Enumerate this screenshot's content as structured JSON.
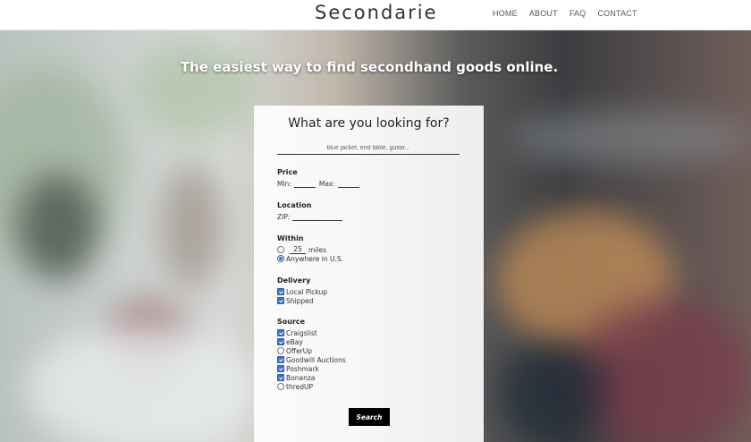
{
  "header": {
    "logo": "Secondarie",
    "nav": [
      "HOME",
      "ABOUT",
      "FAQ",
      "CONTACT"
    ]
  },
  "hero": {
    "tagline": "The easiest way to find secondhand goods online."
  },
  "search": {
    "title": "What are you looking for?",
    "placeholder": "blue jacket, end table, guitar...",
    "price": {
      "label": "Price",
      "min_label": "Min:",
      "max_label": "Max:"
    },
    "location": {
      "label": "Location",
      "zip_label": "ZIP:"
    },
    "within": {
      "label": "Within",
      "miles_value": "25",
      "miles_label": "miles",
      "anywhere_label": "Anywhere in U.S.",
      "selected": "anywhere"
    },
    "delivery": {
      "label": "Delivery",
      "options": [
        {
          "label": "Local Pickup",
          "checked": true
        },
        {
          "label": "Shipped",
          "checked": true
        }
      ]
    },
    "source": {
      "label": "Source",
      "options": [
        {
          "label": "Craigslist",
          "checked": true
        },
        {
          "label": "eBay",
          "checked": true
        },
        {
          "label": "OfferUp",
          "checked": false
        },
        {
          "label": "Goodwill Auctions",
          "checked": true
        },
        {
          "label": "Poshmark",
          "checked": true
        },
        {
          "label": "Bonanza",
          "checked": true
        },
        {
          "label": "thredUP",
          "checked": false
        }
      ]
    },
    "button_label": "Search"
  },
  "colors": {
    "accent": "#3b73c9",
    "button": "#000000",
    "header_bg": "#ffffff"
  }
}
